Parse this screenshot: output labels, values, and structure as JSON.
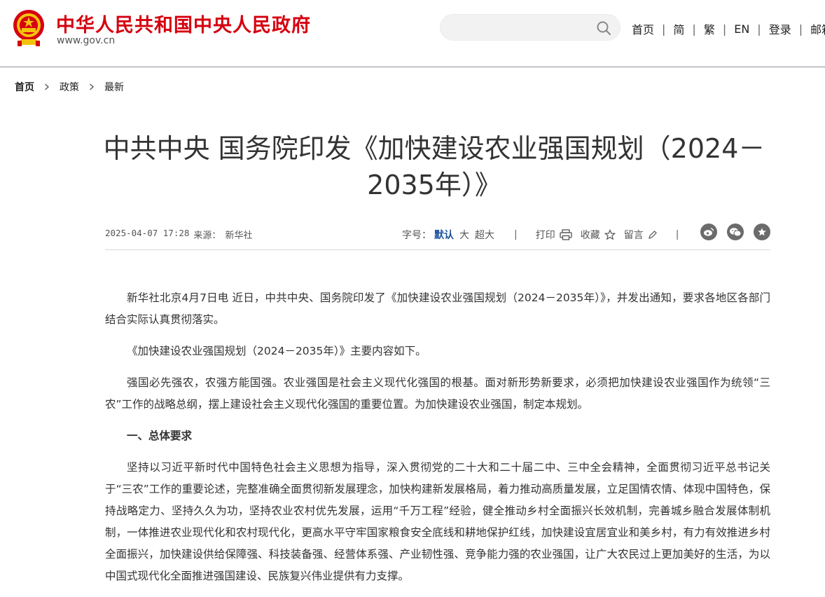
{
  "header": {
    "site_title": "中华人民共和国中央人民政府",
    "site_url": "www.gov.cn",
    "search_placeholder": "",
    "nav": [
      "首页",
      "简",
      "繁",
      "EN",
      "登录",
      "邮箱"
    ]
  },
  "breadcrumb": [
    "首页",
    "政策",
    "最新"
  ],
  "article": {
    "title": "中共中央 国务院印发《加快建设农业强国规划（2024－2035年）》",
    "date": "2025-04-07 17:28",
    "source_label": "来源：",
    "source": "新华社",
    "font_size_label": "字号：",
    "font_sizes": [
      "默认",
      "大",
      "超大"
    ],
    "print_label": "打印",
    "favorite_label": "收藏",
    "comment_label": "留言",
    "paragraphs": [
      {
        "type": "text",
        "text": "新华社北京4月7日电 近日，中共中央、国务院印发了《加快建设农业强国规划（2024－2035年）》，并发出通知，要求各地区各部门结合实际认真贯彻落实。"
      },
      {
        "type": "text",
        "text": "《加快建设农业强国规划（2024－2035年）》主要内容如下。"
      },
      {
        "type": "text",
        "text": "强国必先强农，农强方能国强。农业强国是社会主义现代化强国的根基。面对新形势新要求，必须把加快建设农业强国作为统领“三农”工作的战略总纲，摆上建设社会主义现代化强国的重要位置。为加快建设农业强国，制定本规划。"
      },
      {
        "type": "section",
        "text": "一、总体要求"
      },
      {
        "type": "text",
        "text": "坚持以习近平新时代中国特色社会主义思想为指导，深入贯彻党的二十大和二十届二中、三中全会精神，全面贯彻习近平总书记关于“三农”工作的重要论述，完整准确全面贯彻新发展理念，加快构建新发展格局，着力推动高质量发展，立足国情农情、体现中国特色，保持战略定力、坚持久久为功，坚持农业农村优先发展，运用“千万工程”经验，健全推动乡村全面振兴长效机制，完善城乡融合发展体制机制，一体推进农业现代化和农村现代化，更高水平守牢国家粮食安全底线和耕地保护红线，加快建设宜居宜业和美乡村，有力有效推进乡村全面振兴，加快建设供给保障强、科技装备强、经营体系强、产业韧性强、竞争能力强的农业强国，让广大农民过上更加美好的生活，为以中国式现代化全面推进强国建设、民族复兴伟业提供有力支撑。"
      }
    ]
  },
  "colors": {
    "brand_red": "#d6000f",
    "accent_blue": "#1a4f9c",
    "icon_gray": "#6b6b6b"
  },
  "icons": [
    "national-emblem",
    "search-icon",
    "chevron-right-icon",
    "print-icon",
    "star-outline-icon",
    "pencil-icon",
    "weibo-icon",
    "wechat-icon",
    "star-icon"
  ]
}
